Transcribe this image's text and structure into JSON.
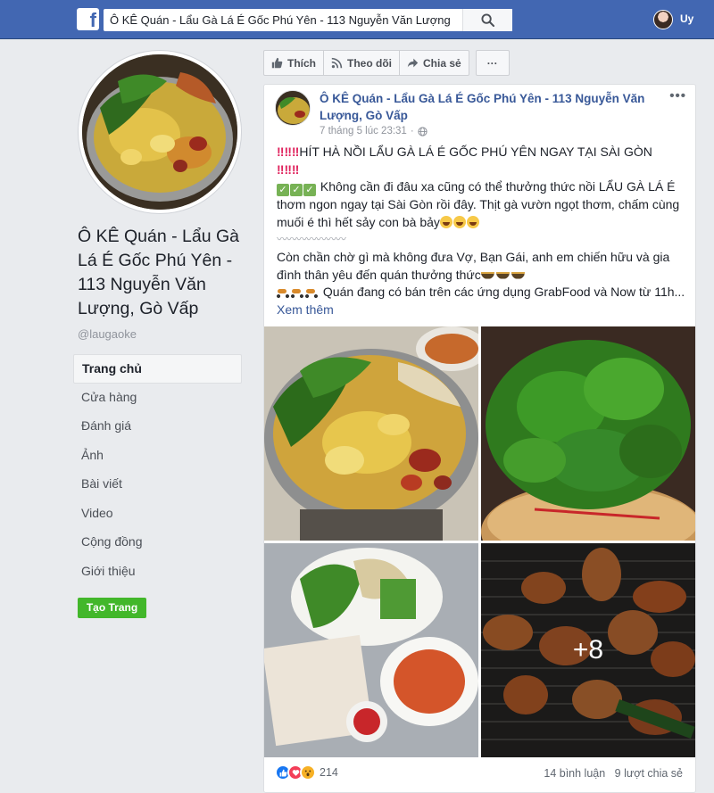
{
  "topbar": {
    "logo": "f",
    "search_value": "Ô KÊ Quán - Lẩu Gà Lá É Gốc Phú Yên - 113 Nguyễn Văn Lượng",
    "user_name": "Uy",
    "brand_color": "#4267b2"
  },
  "page": {
    "title": "Ô KÊ Quán - Lẩu Gà Lá É Gốc Phú Yên - 113 Nguyễn Văn Lượng, Gò Vấp",
    "handle": "@laugaoke"
  },
  "nav": {
    "items": [
      {
        "label": "Trang chủ",
        "active": true
      },
      {
        "label": "Cửa hàng"
      },
      {
        "label": "Đánh giá"
      },
      {
        "label": "Ảnh"
      },
      {
        "label": "Bài viết"
      },
      {
        "label": "Video"
      },
      {
        "label": "Cộng đồng"
      },
      {
        "label": "Giới thiệu"
      }
    ],
    "create_button": "Tạo Trang"
  },
  "actions": {
    "like": "Thích",
    "follow": "Theo dõi",
    "share": "Chia sẻ",
    "more": "···"
  },
  "post": {
    "author": "Ô KÊ Quán - Lẩu Gà Lá É Gốc Phú Yên - 113 Nguyễn Văn Lượng, Gò Vấp",
    "time": "7 tháng 5 lúc 23:31",
    "menu": "•••",
    "line1": "HÍT HÀ NỒI LẨU GÀ LÁ É GỐC PHÚ YÊN NGAY TẠI SÀI GÒN",
    "line2": "Không cần đi đâu xa cũng có thể thưởng thức nồi LẨU GÀ LÁ É thơm ngon ngay tại Sài Gòn rồi đây. Thịt gà vườn ngọt thơm, chấm cùng muối é thì hết sảy con bà bảy",
    "divider": "〰〰〰〰〰〰〰",
    "line3": "Còn chần chờ gì mà không đưa Vợ, Bạn Gái, anh em chiến hữu và gia đình thân yêu đến quán thưởng thức",
    "line4": "Quán đang có bán trên các ứng dụng GrabFood và Now từ 11h...",
    "see_more": "Xem thêm",
    "more_photos": "+8",
    "reaction_count": "214",
    "comments": "14 bình luận",
    "shares": "9 lượt chia sẻ"
  }
}
